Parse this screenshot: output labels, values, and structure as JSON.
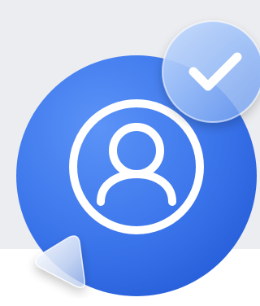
{
  "illustration": {
    "subject": "user-verified",
    "icons": [
      "user-icon",
      "checkmark-icon",
      "play-triangle-icon"
    ],
    "colors": {
      "background_panel": "#ecedf0",
      "page": "#ffffff",
      "circle_light": "#5b93f7",
      "circle_dark": "#1f55d3",
      "icon_stroke": "#ffffff",
      "glass_badge": "#9cc0fb"
    }
  }
}
